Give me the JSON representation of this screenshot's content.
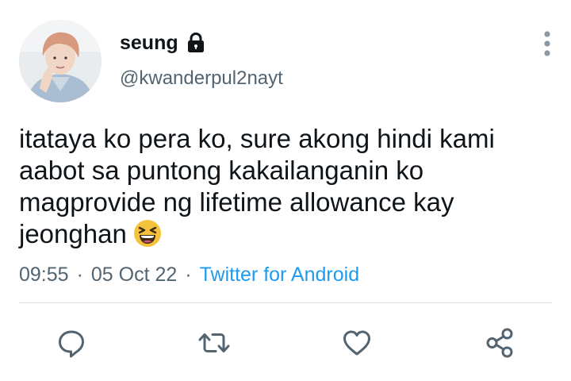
{
  "profile": {
    "display_name": "seung",
    "handle": "@kwanderpul2nayt",
    "avatar_icon": "profile-photo",
    "protected_icon": "lock-icon"
  },
  "tweet": {
    "text": "itataya ko pera ko, sure akong hindi kami aabot sa puntong kakailanganin ko magprovide ng lifetime allowance kay jeonghan",
    "emoji": "grinning-squinting-face-emoji",
    "time": "09:55",
    "date": "05 Oct 22",
    "separator": "·",
    "source": "Twitter for Android"
  },
  "actions": {
    "reply_icon": "reply-icon",
    "retweet_icon": "retweet-icon",
    "like_icon": "heart-icon",
    "share_icon": "share-icon",
    "more_icon": "more-vertical-icon"
  },
  "colors": {
    "text": "#0f1419",
    "secondary_text": "#536471",
    "link": "#1d9bf0",
    "divider": "#dde3e8",
    "emoji_yellow": "#f5c33b"
  }
}
